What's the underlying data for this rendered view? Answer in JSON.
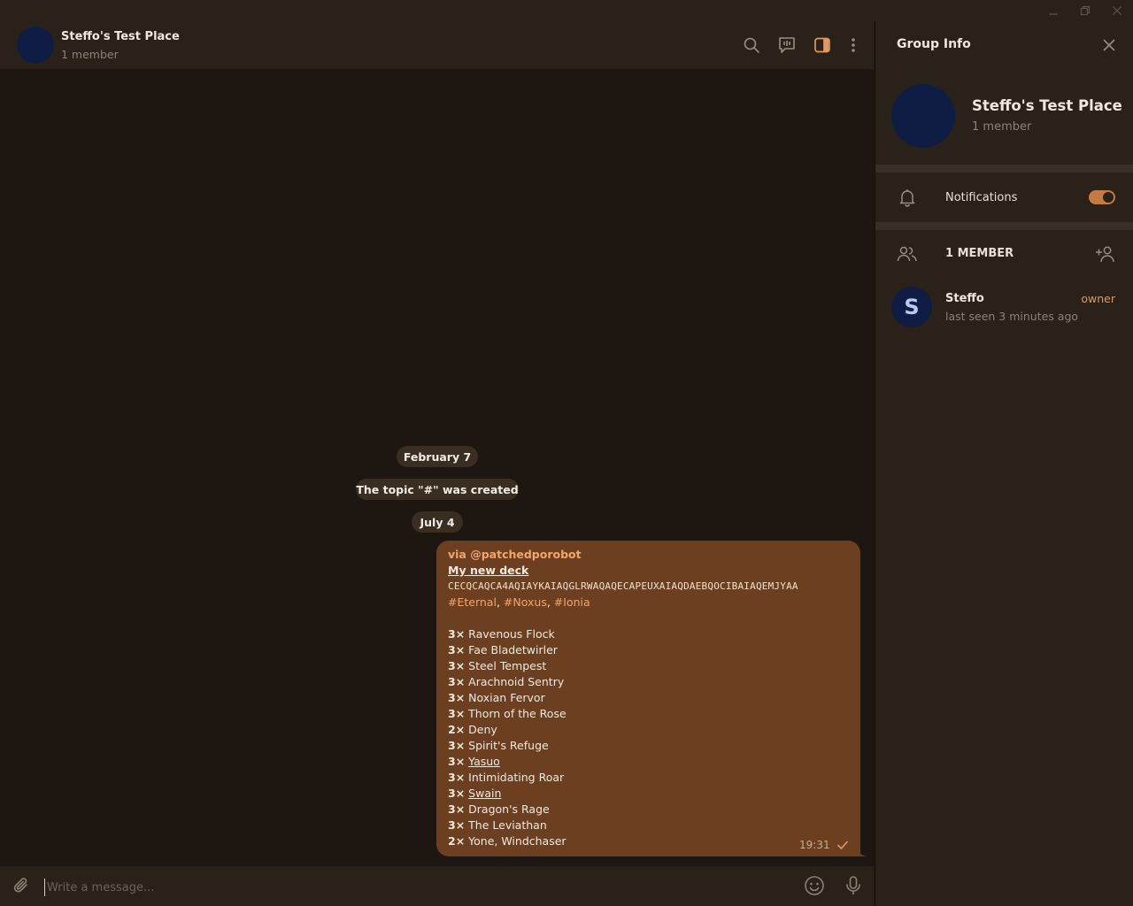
{
  "window": {
    "controls": [
      "minimize",
      "restore",
      "close"
    ]
  },
  "chat_header": {
    "title": "Steffo's Test Place",
    "subtitle": "1 member",
    "icons": [
      "search-icon",
      "video-chat-icon",
      "sidebar-toggle-icon",
      "more-icon"
    ],
    "accent_color": "#e29760"
  },
  "services": {
    "date1": "February 7",
    "topic_created": "The topic \"#\" was created",
    "date2": "July 4"
  },
  "message": {
    "via": "via @patchedporobot",
    "deck_title": "My new deck",
    "deck_code": "CECQCAQCA4AQIAYKAIAQGLRWAQAQECAPEUXAIAQDAEBQOCIBAIAQEMJYAA",
    "tags": [
      "#Eternal",
      "#Noxus",
      "#Ionia"
    ],
    "cards": [
      {
        "count": "3×",
        "name": "Ravenous Flock"
      },
      {
        "count": "3×",
        "name": "Fae Bladetwirler"
      },
      {
        "count": "3×",
        "name": "Steel Tempest"
      },
      {
        "count": "3×",
        "name": "Arachnoid Sentry"
      },
      {
        "count": "3×",
        "name": "Noxian Fervor"
      },
      {
        "count": "3×",
        "name": "Thorn of the Rose"
      },
      {
        "count": "2×",
        "name": "Deny"
      },
      {
        "count": "3×",
        "name": "Spirit's Refuge"
      },
      {
        "count": "3×",
        "name": "Yasuo"
      },
      {
        "count": "3×",
        "name": "Intimidating Roar"
      },
      {
        "count": "3×",
        "name": "Swain"
      },
      {
        "count": "3×",
        "name": "Dragon's Rage"
      },
      {
        "count": "3×",
        "name": "The Leviathan"
      },
      {
        "count": "2×",
        "name": "Yone, Windchaser"
      }
    ],
    "time": "19:31",
    "bubble_color": "#6b3f20"
  },
  "composer": {
    "placeholder": "Write a message..."
  },
  "group_info": {
    "title": "Group Info",
    "name": "Steffo's Test Place",
    "subtitle": "1 member",
    "notifications_label": "Notifications",
    "notifications_on": true,
    "members_header": "1 MEMBER",
    "members": [
      {
        "initial": "S",
        "name": "Steffo",
        "status": "last seen 3 minutes ago",
        "role": "owner"
      }
    ]
  }
}
